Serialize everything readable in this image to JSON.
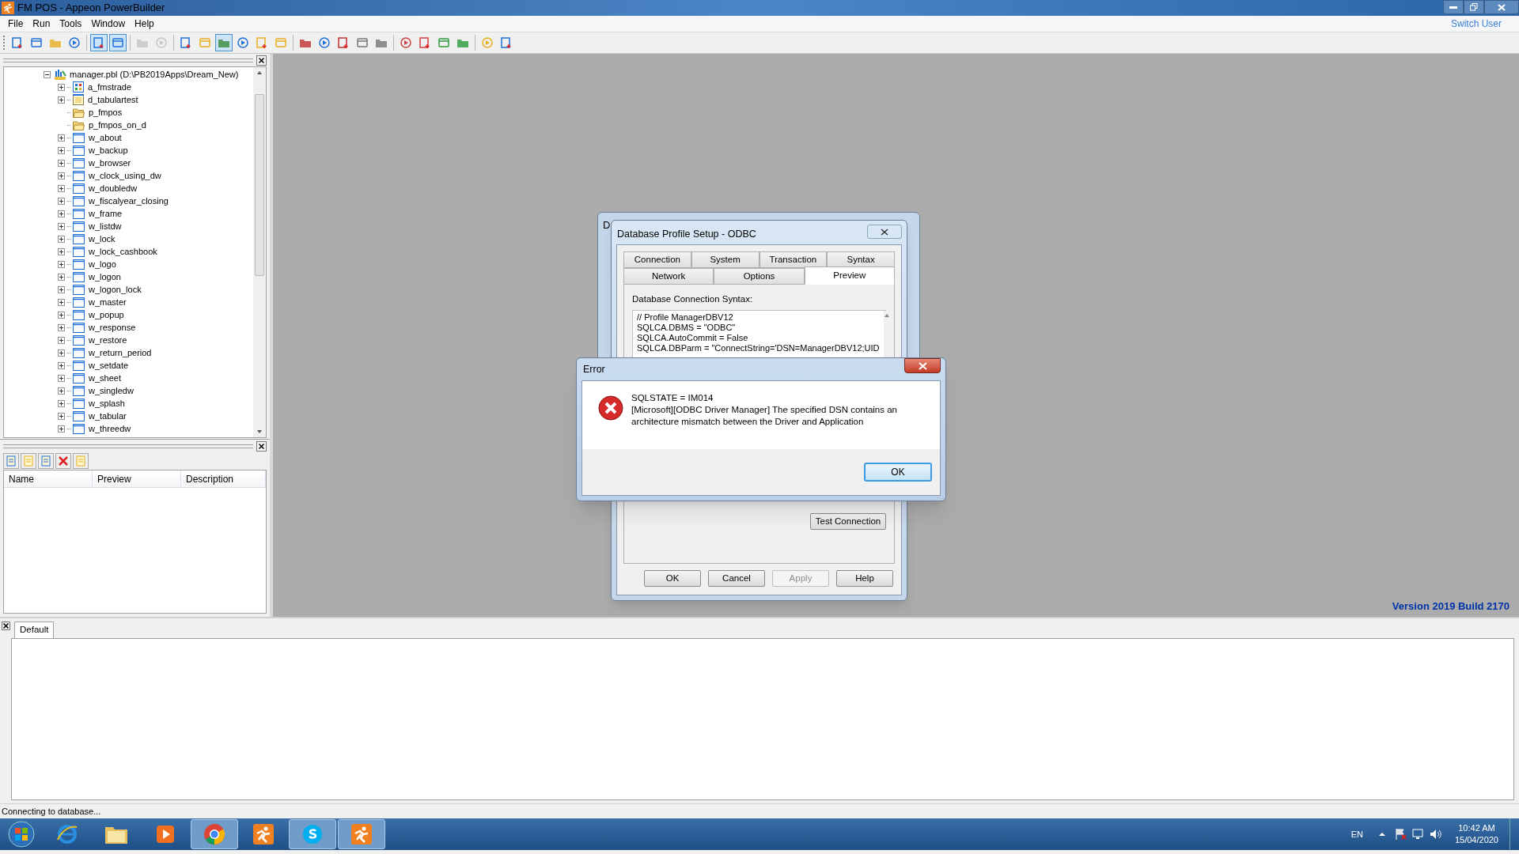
{
  "window": {
    "title": "FM POS - Appeon PowerBuilder"
  },
  "menu": [
    "File",
    "Run",
    "Tools",
    "Window",
    "Help"
  ],
  "switch_user": "Switch User",
  "toolbar": [
    {
      "pressed": false,
      "disabled": false
    },
    {
      "pressed": false,
      "disabled": false
    },
    {
      "pressed": false,
      "disabled": false
    },
    {
      "pressed": false,
      "disabled": false
    },
    {
      "pressed": true,
      "disabled": false
    },
    {
      "pressed": true,
      "disabled": false
    },
    {
      "pressed": false,
      "disabled": true
    },
    {
      "pressed": false,
      "disabled": true
    },
    {
      "pressed": false,
      "disabled": false
    },
    {
      "pressed": false,
      "disabled": false
    },
    {
      "pressed": true,
      "disabled": false
    },
    {
      "pressed": false,
      "disabled": false
    },
    {
      "pressed": false,
      "disabled": false
    },
    {
      "pressed": false,
      "disabled": false
    },
    {
      "pressed": false,
      "disabled": false
    },
    {
      "pressed": false,
      "disabled": false
    },
    {
      "pressed": false,
      "disabled": false
    },
    {
      "pressed": false,
      "disabled": false
    },
    {
      "pressed": false,
      "disabled": false
    },
    {
      "pressed": false,
      "disabled": false
    },
    {
      "pressed": false,
      "disabled": false
    },
    {
      "pressed": false,
      "disabled": false
    },
    {
      "pressed": false,
      "disabled": false
    },
    {
      "pressed": false,
      "disabled": false
    },
    {
      "pressed": false,
      "disabled": false
    }
  ],
  "tree": {
    "label": "manager.pbl (D:\\PB2019Apps\\Dream_New)",
    "expanded": true,
    "children": [
      {
        "label": "a_fmstrade",
        "kind": "application",
        "expandable": true
      },
      {
        "label": "d_tabulartest",
        "kind": "datawindow",
        "expandable": true
      },
      {
        "label": "p_fmpos",
        "kind": "pipeline",
        "expandable": false
      },
      {
        "label": "p_fmpos_on_d",
        "kind": "pipeline",
        "expandable": false
      },
      {
        "label": "w_about",
        "kind": "window",
        "expandable": true
      },
      {
        "label": "w_backup",
        "kind": "window",
        "expandable": true
      },
      {
        "label": "w_browser",
        "kind": "window",
        "expandable": true
      },
      {
        "label": "w_clock_using_dw",
        "kind": "window",
        "expandable": true
      },
      {
        "label": "w_doubledw",
        "kind": "window",
        "expandable": true
      },
      {
        "label": "w_fiscalyear_closing",
        "kind": "window",
        "expandable": true
      },
      {
        "label": "w_frame",
        "kind": "window",
        "expandable": true
      },
      {
        "label": "w_listdw",
        "kind": "window",
        "expandable": true
      },
      {
        "label": "w_lock",
        "kind": "window",
        "expandable": true
      },
      {
        "label": "w_lock_cashbook",
        "kind": "window",
        "expandable": true
      },
      {
        "label": "w_logo",
        "kind": "window",
        "expandable": true
      },
      {
        "label": "w_logon",
        "kind": "window",
        "expandable": true
      },
      {
        "label": "w_logon_lock",
        "kind": "window",
        "expandable": true
      },
      {
        "label": "w_master",
        "kind": "window",
        "expandable": true
      },
      {
        "label": "w_popup",
        "kind": "window",
        "expandable": true
      },
      {
        "label": "w_response",
        "kind": "window",
        "expandable": true
      },
      {
        "label": "w_restore",
        "kind": "window",
        "expandable": true
      },
      {
        "label": "w_return_period",
        "kind": "window",
        "expandable": true
      },
      {
        "label": "w_setdate",
        "kind": "window",
        "expandable": true
      },
      {
        "label": "w_sheet",
        "kind": "window",
        "expandable": true
      },
      {
        "label": "w_singledw",
        "kind": "window",
        "expandable": true
      },
      {
        "label": "w_splash",
        "kind": "window",
        "expandable": true
      },
      {
        "label": "w_tabular",
        "kind": "window",
        "expandable": true
      },
      {
        "label": "w_threedw",
        "kind": "window",
        "expandable": true
      }
    ]
  },
  "list_view": {
    "columns": [
      "Name",
      "Preview",
      "Description"
    ]
  },
  "version": "Version 2019 Build 2170",
  "behind_dialog": {
    "title": "D"
  },
  "profile_dialog": {
    "title": "Database Profile Setup - ODBC",
    "tab_rows": [
      [
        {
          "label": "Connection",
          "selected": false
        },
        {
          "label": "System",
          "selected": false
        },
        {
          "label": "Transaction",
          "selected": false
        },
        {
          "label": "Syntax",
          "selected": false
        }
      ],
      [
        {
          "label": "Network",
          "selected": false
        },
        {
          "label": "Options",
          "selected": false
        },
        {
          "label": "Preview",
          "selected": true
        }
      ]
    ],
    "syntax_label": "Database Connection Syntax:",
    "syntax_lines": [
      "// Profile ManagerDBV12",
      "SQLCA.DBMS = \"ODBC\"",
      "SQLCA.AutoCommit = False",
      "SQLCA.DBParm = \"ConnectString='DSN=ManagerDBV12;UID"
    ],
    "test_button": "Test Connection",
    "buttons": [
      {
        "label": "OK",
        "disabled": false
      },
      {
        "label": "Cancel",
        "disabled": false
      },
      {
        "label": "Apply",
        "disabled": true
      },
      {
        "label": "Help",
        "disabled": false
      }
    ]
  },
  "error_dialog": {
    "title": "Error",
    "heading": "SQLSTATE = IM014",
    "message_lines": [
      "[Microsoft][ODBC Driver Manager] The specified DSN contains an",
      "architecture mismatch between the Driver and Application"
    ],
    "button": "OK"
  },
  "output": {
    "tabs": [
      {
        "label": "Default",
        "selected": true
      }
    ]
  },
  "status_bar": "Connecting to database...",
  "taskbar": {
    "apps": [
      {
        "kind": "browser-e",
        "active": false
      },
      {
        "kind": "folder",
        "active": false
      },
      {
        "kind": "media",
        "active": false
      },
      {
        "kind": "chrome",
        "active": true
      },
      {
        "kind": "runner",
        "active": false
      },
      {
        "kind": "skype",
        "active": true
      },
      {
        "kind": "runner",
        "active": true
      }
    ],
    "language": "EN",
    "time": "10:42 AM",
    "date": "15/04/2020"
  }
}
